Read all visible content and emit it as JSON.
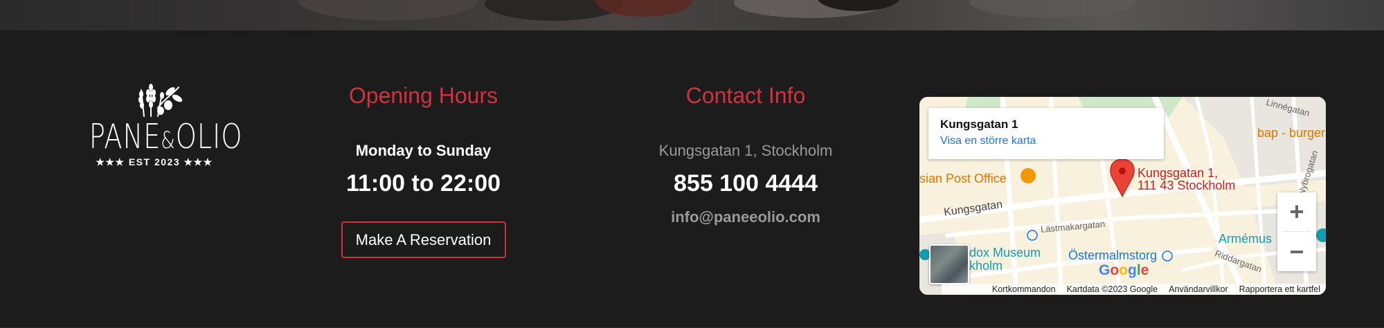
{
  "logo": {
    "name": "PANE&OLIO",
    "tagline": "★★★ EST 2023 ★★★"
  },
  "hours": {
    "title": "Opening Hours",
    "days": "Monday to Sunday",
    "time": "11:00 to 22:00",
    "reserve_label": "Make A Reservation"
  },
  "contact": {
    "title": "Contact Info",
    "address": "Kungsgatan 1, Stockholm",
    "phone": "855 100 4444",
    "email": "info@paneeolio.com"
  },
  "map": {
    "card_title": "Kungsgatan 1",
    "card_link": "Visa en större karta",
    "pin_label_1": "Kungsgatan 1,",
    "pin_label_2": "111 43 Stockholm",
    "labels": {
      "post_office": "sian Post Office",
      "bap": "bap - burgers &",
      "kungsgatan": "Kungsgatan",
      "lastmakargatan": "Lästmakargatan",
      "museum_1": "dox Museum",
      "museum_2": "kholm",
      "ostermalmstorg": "Östermalmstorg",
      "armemus": "Armémus",
      "riddargatan": "Riddargatan",
      "nybrogatan": "Nybrogatan",
      "linnegatan": "Linnégatan"
    },
    "google": "Google",
    "footer": [
      "Kortkommandon",
      "Kartdata ©2023 Google",
      "Användarvillkor",
      "Rapportera ett kartfel"
    ],
    "zoom_in": "+",
    "zoom_out": "−"
  },
  "colors": {
    "accent": "#d2323f",
    "background": "#1c1c1c",
    "muted_text": "#9a9a9a",
    "map_link": "#1a73e8",
    "map_pin": "#ea4335",
    "map_poi_orange": "#e37400",
    "map_teal": "#129eaf"
  }
}
